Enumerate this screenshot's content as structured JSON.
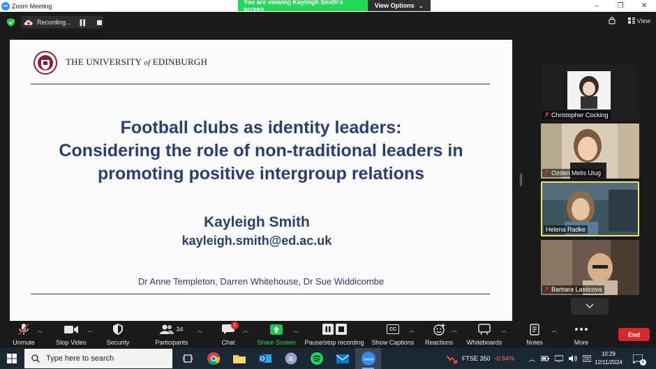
{
  "window": {
    "title": "Zoom Meeting",
    "share_banner": "You are viewing Kayleigh Smith's screen",
    "view_options": "View Options",
    "controls": [
      "–",
      "❐",
      "✕"
    ]
  },
  "topbar": {
    "recording_label": "Recording...",
    "view_label": "View"
  },
  "slide": {
    "university": "THE UNIVERSITY",
    "university_of": "of",
    "university_city": "EDINBURGH",
    "title_lines": [
      "Football clubs as identity leaders:",
      "Considering the role of non-traditional leaders in",
      "promoting positive intergroup relations"
    ],
    "presenter": "Kayleigh Smith",
    "email": "kayleigh.smith@ed.ac.uk",
    "coauthors": "Dr Anne Templeton, Darren Whitehouse, Dr Sue Widdicombe"
  },
  "participants": [
    {
      "name": "Christopher Cocking",
      "muted": true
    },
    {
      "name": "Ozden Melis Ulug",
      "muted": true
    },
    {
      "name": "Helena Radke",
      "muted": false,
      "active_speaker": true
    },
    {
      "name": "Barbara Lasticova",
      "muted": true
    }
  ],
  "toolbar": {
    "unmute": "Unmute",
    "stop_video": "Stop Video",
    "security": "Security",
    "participants": "Participants",
    "participants_count": "34",
    "chat": "Chat",
    "chat_badge": "1",
    "share_screen": "Share Screen",
    "pause_recording": "Pause/stop recording",
    "captions": "Show Captions",
    "captions_icon": "CC",
    "reactions": "Reactions",
    "whiteboards": "Whiteboards",
    "notes": "Notes",
    "more": "More",
    "end": "End"
  },
  "taskbar": {
    "search_placeholder": "Type here to search",
    "ticker_symbol": "FTSE 350",
    "ticker_change": "-0.94%",
    "time": "10:29",
    "date": "12/11/2024",
    "notification_count": "6"
  },
  "colors": {
    "share_green": "#23d959",
    "slide_navy": "#2a3f6c",
    "end_red": "#d9282b",
    "active_speaker": "#e9e46a"
  }
}
